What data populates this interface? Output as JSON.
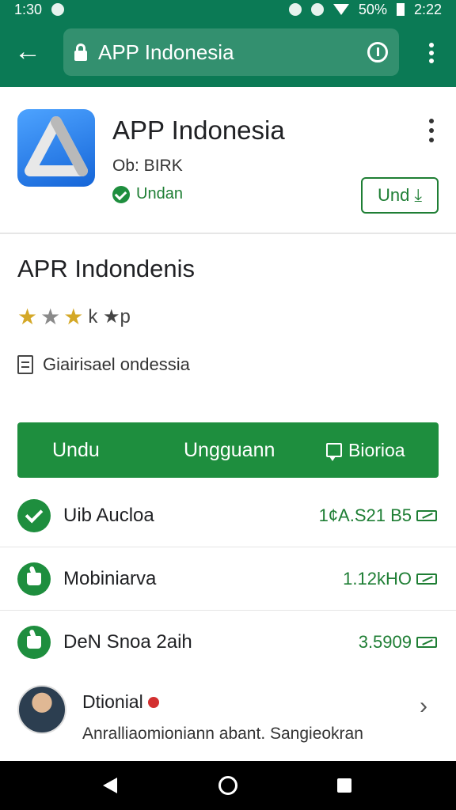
{
  "status_bar": {
    "time_left": "1:30",
    "battery": "50%",
    "clock": "2:22"
  },
  "browser": {
    "url": "APP Indonesia"
  },
  "app": {
    "name": "APP Indonesia",
    "developer": "Ob: BIRK",
    "verified_label": "Undan",
    "install_label": "Und"
  },
  "details": {
    "title": "APR Indondenis",
    "rating": {
      "stars": 3,
      "max": 5,
      "suffix": "k ★p"
    },
    "category": "Giairisael ondessia"
  },
  "actions": {
    "item1": "Undu",
    "item2": "Ungguann",
    "item3": "Biorioa"
  },
  "list": [
    {
      "label": "Uib Aucloa",
      "value": "1¢A.S21 B5"
    },
    {
      "label": "Mobiniarva",
      "value": "1.12kHO"
    },
    {
      "label": "DeN Snoa 2aih",
      "value": "3.5909"
    }
  ],
  "review": {
    "name": "Dtionial",
    "text": "Anralliaomioniann abant. Sangieokran"
  },
  "colors": {
    "primary": "#0b7a55",
    "accent": "#1e8e3e",
    "star": "#d4a827"
  }
}
